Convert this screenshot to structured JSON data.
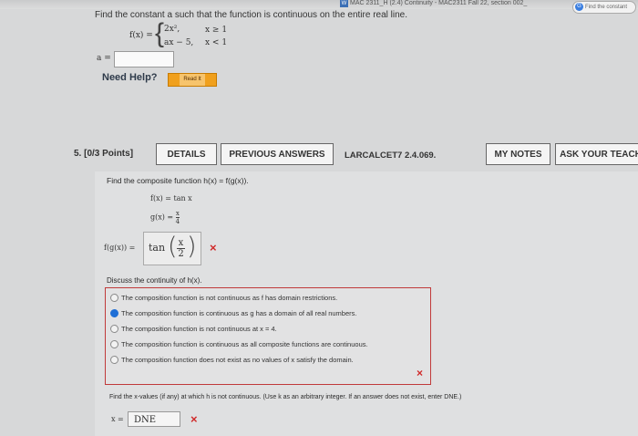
{
  "browser": {
    "tab_badge": "W",
    "tab_title": "MAC 2311_H (2.4) Continuity - MAC2311 Fall 22, section 002_",
    "pill_icon": "G",
    "pill_text": "Find the constant"
  },
  "question4": {
    "prompt": "Find the constant a such that the function is continuous on the entire real line.",
    "f_label": "f(x) =",
    "piece1_expr": "2x²,",
    "piece1_cond": "x ≥ 1",
    "piece2_expr": "ax − 5,",
    "piece2_cond": "x < 1",
    "answer_label": "a =",
    "answer_value": "",
    "need_help": "Need Help?",
    "read_it": "Read It"
  },
  "question5": {
    "number": "5.",
    "points": "[0/3 Points]",
    "details_btn": "DETAILS",
    "prev_answers_btn": "PREVIOUS ANSWERS",
    "citation": "LARCALCET7 2.4.069.",
    "my_notes_btn": "MY NOTES",
    "ask_teacher_btn": "ASK YOUR TEACH",
    "prompt": "Find the composite function h(x) = f(g(x)).",
    "f_def": "f(x) = tan x",
    "g_def_left": "g(x) = ",
    "g_def_num": "x",
    "g_def_den": "4",
    "fg_label": "f(g(x)) =",
    "fg_answer_func": "tan",
    "fg_answer_num": "x",
    "fg_answer_den": "2",
    "wrong_mark": "×",
    "discuss": "Discuss the continuity of h(x).",
    "options": [
      {
        "label": "The composition function is not continuous as f has domain restrictions.",
        "selected": false
      },
      {
        "label": "The composition function is continuous as g has a domain of all real numbers.",
        "selected": true
      },
      {
        "label": "The composition function is not continuous at x = 4.",
        "selected": false
      },
      {
        "label": "The composition function is continuous as all composite functions are continuous.",
        "selected": false
      },
      {
        "label": "The composition function does not exist as no values of x satisfy the domain.",
        "selected": false
      }
    ],
    "options_wrong_mark": "×",
    "find_x_prompt": "Find the x-values (if any) at which h is not continuous. (Use k as an arbitrary integer. If an answer does not exist, enter DNE.)",
    "x_label": "x =",
    "x_answer": "DNE",
    "x_wrong_mark": "×"
  },
  "colors": {
    "selected_radio": "#1f6fd6",
    "wrong_red": "#d02a2a",
    "read_it_orange": "#f0a01d"
  }
}
